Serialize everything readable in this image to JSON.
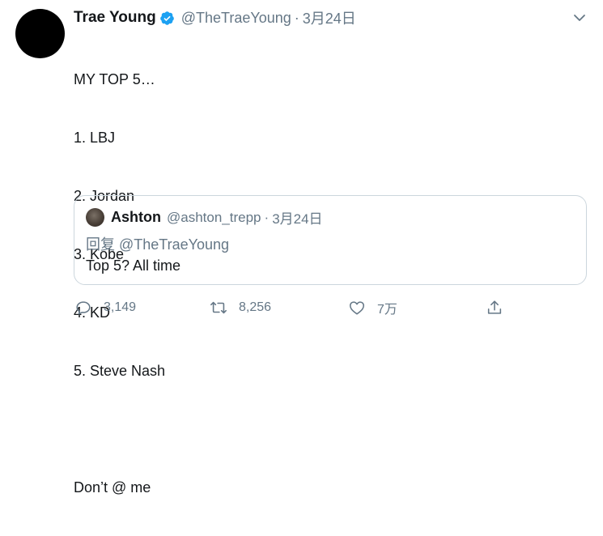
{
  "tweet": {
    "display_name": "Trae Young",
    "handle": "@TheTraeYoung",
    "separator": "·",
    "date": "3月24日",
    "text_lines": [
      "MY TOP 5…",
      "1. LBJ",
      "2. Jordan",
      "3. Kobe",
      "4. KD",
      "5. Steve Nash",
      "",
      "Don’t @ me"
    ]
  },
  "quote": {
    "display_name": "Ashton",
    "handle": "@ashton_trepp",
    "separator": "·",
    "date": "3月24日",
    "reply_prefix": "回复",
    "reply_mention": "@TheTraeYoung",
    "text": "Top 5? All time"
  },
  "actions": {
    "reply_count": "3,149",
    "retweet_count": "8,256",
    "like_count": "7万"
  },
  "colors": {
    "verified_badge": "#1da1f2",
    "secondary_text": "#657786",
    "primary_text": "#14171a",
    "border": "#ccd6dd"
  },
  "icons": {
    "verified": "verified-badge-icon",
    "caret": "chevron-down-icon",
    "reply": "reply-icon",
    "retweet": "retweet-icon",
    "like": "heart-icon",
    "share": "share-icon"
  }
}
